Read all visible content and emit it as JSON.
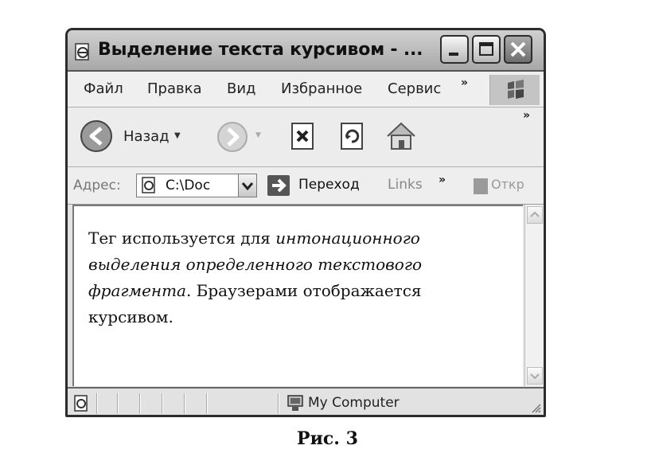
{
  "window": {
    "title": "Выделение текста курсивом - ..."
  },
  "menu": {
    "items": [
      "Файл",
      "Правка",
      "Вид",
      "Избранное",
      "Сервис"
    ],
    "more": "»"
  },
  "toolbar": {
    "back_label": "Назад",
    "more": "»"
  },
  "address": {
    "label": "Адрес:",
    "value": "C:\\Doc",
    "go_label": "Переход",
    "links_label": "Links",
    "links_more": "»",
    "open_label": "Откр"
  },
  "content": {
    "text_start": "Тег используется для ",
    "text_italic": "интонационного выделения определенного текстового фрагмента",
    "text_end": ". Браузерами отображается курсивом."
  },
  "status": {
    "zone": "My Computer"
  },
  "caption": "Рис. 3"
}
